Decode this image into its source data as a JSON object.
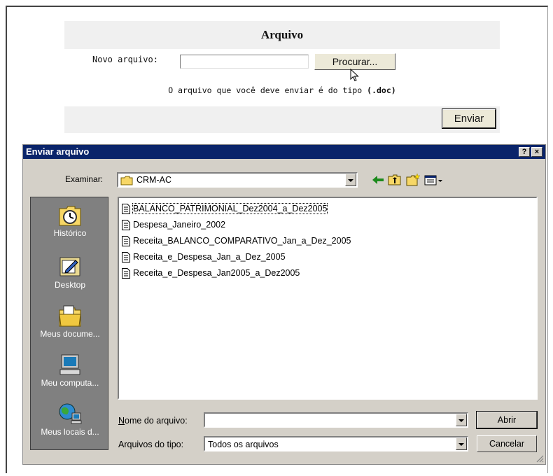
{
  "web_form": {
    "title": "Arquivo",
    "file_label": "Novo arquivo: ",
    "file_value": "",
    "browse_label": "Procurar...",
    "hint_text": "O arquivo que você deve enviar é do tipo ",
    "hint_type": "(.doc)",
    "send_label": "Enviar"
  },
  "dialog": {
    "title": "Enviar arquivo",
    "help_btn": "?",
    "close_btn": "×",
    "look_in_label": "Examinar:",
    "look_in_value": "CRM-AC",
    "places": [
      {
        "label": "Histórico",
        "icon": "history-icon"
      },
      {
        "label": "Desktop",
        "icon": "desktop-icon"
      },
      {
        "label": "Meus docume...",
        "icon": "my-documents-icon"
      },
      {
        "label": "Meu computa...",
        "icon": "my-computer-icon"
      },
      {
        "label": "Meus locais d...",
        "icon": "network-places-icon"
      }
    ],
    "files": [
      {
        "name": "BALANCO_PATRIMONIAL_Dez2004_a_Dez2005",
        "selected": true
      },
      {
        "name": "Despesa_Janeiro_2002"
      },
      {
        "name": "Receita_BALANCO_COMPARATIVO_Jan_a_Dez_2005"
      },
      {
        "name": "Receita_e_Despesa_Jan_a_Dez_2005"
      },
      {
        "name": "Receita_e_Despesa_Jan2005_a_Dez2005"
      }
    ],
    "filename_label": "Nome do arquivo:",
    "filename_value": "",
    "filetype_label": "Arquivos do tipo:",
    "filetype_value": "Todos os arquivos",
    "open_label": "Abrir",
    "cancel_label": "Cancelar"
  }
}
